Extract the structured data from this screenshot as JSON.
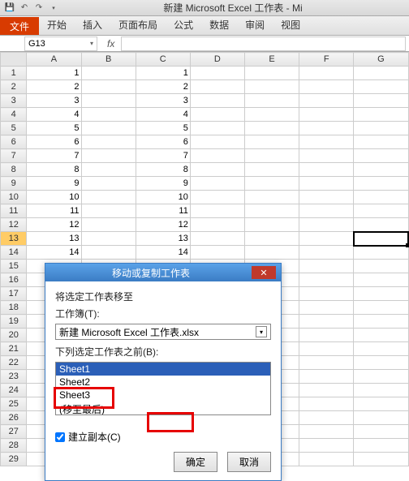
{
  "titlebar": {
    "title": "新建 Microsoft Excel 工作表 - Mi"
  },
  "ribbon": {
    "file": "文件",
    "tabs": [
      "开始",
      "插入",
      "页面布局",
      "公式",
      "数据",
      "审阅",
      "视图"
    ]
  },
  "namebox": {
    "value": "G13"
  },
  "fx": "fx",
  "columns": [
    "A",
    "B",
    "C",
    "D",
    "E",
    "F",
    "G"
  ],
  "rows": [
    {
      "n": 1,
      "a": "1",
      "c": "1"
    },
    {
      "n": 2,
      "a": "2",
      "c": "2"
    },
    {
      "n": 3,
      "a": "3",
      "c": "3"
    },
    {
      "n": 4,
      "a": "4",
      "c": "4"
    },
    {
      "n": 5,
      "a": "5",
      "c": "5"
    },
    {
      "n": 6,
      "a": "6",
      "c": "6"
    },
    {
      "n": 7,
      "a": "7",
      "c": "7"
    },
    {
      "n": 8,
      "a": "8",
      "c": "8"
    },
    {
      "n": 9,
      "a": "9",
      "c": "9"
    },
    {
      "n": 10,
      "a": "10",
      "c": "10"
    },
    {
      "n": 11,
      "a": "11",
      "c": "11"
    },
    {
      "n": 12,
      "a": "12",
      "c": "12"
    },
    {
      "n": 13,
      "a": "13",
      "c": "13"
    },
    {
      "n": 14,
      "a": "14",
      "c": "14"
    },
    {
      "n": 15,
      "a": "",
      "c": ""
    },
    {
      "n": 16,
      "a": "",
      "c": ""
    },
    {
      "n": 17,
      "a": "",
      "c": ""
    },
    {
      "n": 18,
      "a": "",
      "c": ""
    },
    {
      "n": 19,
      "a": "",
      "c": ""
    },
    {
      "n": 20,
      "a": "",
      "c": ""
    },
    {
      "n": 21,
      "a": "",
      "c": ""
    },
    {
      "n": 22,
      "a": "",
      "c": ""
    },
    {
      "n": 23,
      "a": "",
      "c": ""
    },
    {
      "n": 24,
      "a": "",
      "c": ""
    },
    {
      "n": 25,
      "a": "",
      "c": ""
    },
    {
      "n": 26,
      "a": "",
      "c": ""
    },
    {
      "n": 27,
      "a": "",
      "c": ""
    },
    {
      "n": 28,
      "a": "",
      "c": ""
    },
    {
      "n": 29,
      "a": "",
      "c": ""
    }
  ],
  "dialog": {
    "title": "移动或复制工作表",
    "label1": "将选定工作表移至",
    "label2": "工作簿(T):",
    "workbook": "新建 Microsoft Excel 工作表.xlsx",
    "label3": "下列选定工作表之前(B):",
    "sheets": [
      "Sheet1",
      "Sheet2",
      "Sheet3",
      "(移至最后)"
    ],
    "checkbox": "建立副本(C)",
    "ok": "确定",
    "cancel": "取消"
  }
}
